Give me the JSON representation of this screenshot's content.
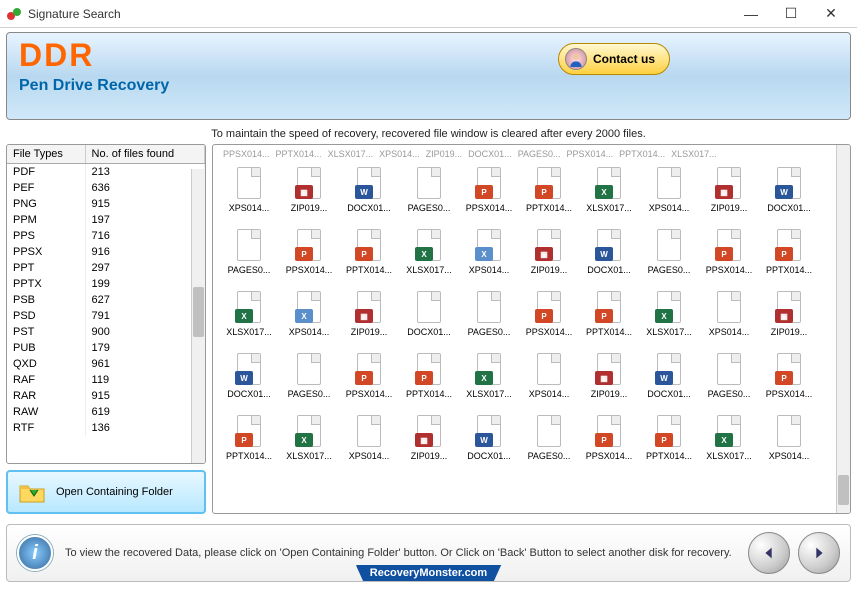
{
  "window": {
    "title": "Signature Search"
  },
  "header": {
    "logo_text": "DDR",
    "subtitle": "Pen Drive Recovery",
    "contact_label": "Contact us"
  },
  "notice": "To maintain the speed of recovery, recovered file window is cleared after every 2000 files.",
  "filetypes": {
    "columns": [
      "File Types",
      "No. of files found"
    ],
    "rows": [
      {
        "type": "PDF",
        "count": "213"
      },
      {
        "type": "PEF",
        "count": "636"
      },
      {
        "type": "PNG",
        "count": "915"
      },
      {
        "type": "PPM",
        "count": "197"
      },
      {
        "type": "PPS",
        "count": "716"
      },
      {
        "type": "PPSX",
        "count": "916"
      },
      {
        "type": "PPT",
        "count": "297"
      },
      {
        "type": "PPTX",
        "count": "199"
      },
      {
        "type": "PSB",
        "count": "627"
      },
      {
        "type": "PSD",
        "count": "791"
      },
      {
        "type": "PST",
        "count": "900"
      },
      {
        "type": "PUB",
        "count": "179"
      },
      {
        "type": "QXD",
        "count": "961"
      },
      {
        "type": "RAF",
        "count": "119"
      },
      {
        "type": "RAR",
        "count": "915"
      },
      {
        "type": "RAW",
        "count": "619"
      },
      {
        "type": "RTF",
        "count": "136"
      }
    ]
  },
  "open_folder_label": "Open Containing Folder",
  "files_truncated_row": [
    "PPSX014...",
    "PPTX014...",
    "XLSX017...",
    "XPS014...",
    "ZIP019...",
    "DOCX01...",
    "PAGES0...",
    "PPSX014...",
    "PPTX014...",
    "XLSX017..."
  ],
  "file_grid": [
    [
      {
        "name": "XPS014...",
        "kind": "page"
      },
      {
        "name": "ZIP019...",
        "kind": "zip"
      },
      {
        "name": "DOCX01...",
        "kind": "docx"
      },
      {
        "name": "PAGES0...",
        "kind": "page"
      },
      {
        "name": "PPSX014...",
        "kind": "pptx"
      },
      {
        "name": "PPTX014...",
        "kind": "pptx"
      },
      {
        "name": "XLSX017...",
        "kind": "xlsx"
      },
      {
        "name": "XPS014...",
        "kind": "page"
      },
      {
        "name": "ZIP019...",
        "kind": "zip"
      },
      {
        "name": "DOCX01...",
        "kind": "docx"
      }
    ],
    [
      {
        "name": "PAGES0...",
        "kind": "page"
      },
      {
        "name": "PPSX014...",
        "kind": "pptx"
      },
      {
        "name": "PPTX014...",
        "kind": "pptx"
      },
      {
        "name": "XLSX017...",
        "kind": "xlsx"
      },
      {
        "name": "XPS014...",
        "kind": "xps"
      },
      {
        "name": "ZIP019...",
        "kind": "zip"
      },
      {
        "name": "DOCX01...",
        "kind": "docx"
      },
      {
        "name": "PAGES0...",
        "kind": "page"
      },
      {
        "name": "PPSX014...",
        "kind": "pptx"
      },
      {
        "name": "PPTX014...",
        "kind": "pptx"
      }
    ],
    [
      {
        "name": "XLSX017...",
        "kind": "xlsx"
      },
      {
        "name": "XPS014...",
        "kind": "xps"
      },
      {
        "name": "ZIP019...",
        "kind": "zip"
      },
      {
        "name": "DOCX01...",
        "kind": "page"
      },
      {
        "name": "PAGES0...",
        "kind": "page"
      },
      {
        "name": "PPSX014...",
        "kind": "pptx"
      },
      {
        "name": "PPTX014...",
        "kind": "pptx"
      },
      {
        "name": "XLSX017...",
        "kind": "xlsx"
      },
      {
        "name": "XPS014...",
        "kind": "page"
      },
      {
        "name": "ZIP019...",
        "kind": "zip"
      }
    ],
    [
      {
        "name": "DOCX01...",
        "kind": "docx"
      },
      {
        "name": "PAGES0...",
        "kind": "page"
      },
      {
        "name": "PPSX014...",
        "kind": "pptx"
      },
      {
        "name": "PPTX014...",
        "kind": "pptx"
      },
      {
        "name": "XLSX017...",
        "kind": "xlsx"
      },
      {
        "name": "XPS014...",
        "kind": "page"
      },
      {
        "name": "ZIP019...",
        "kind": "zip"
      },
      {
        "name": "DOCX01...",
        "kind": "docx"
      },
      {
        "name": "PAGES0...",
        "kind": "page"
      },
      {
        "name": "PPSX014...",
        "kind": "pptx"
      }
    ],
    [
      {
        "name": "PPTX014...",
        "kind": "pptx"
      },
      {
        "name": "XLSX017...",
        "kind": "xlsx"
      },
      {
        "name": "XPS014...",
        "kind": "page"
      },
      {
        "name": "ZIP019...",
        "kind": "zip"
      },
      {
        "name": "DOCX01...",
        "kind": "docx"
      },
      {
        "name": "PAGES0...",
        "kind": "page"
      },
      {
        "name": "PPSX014...",
        "kind": "pptx"
      },
      {
        "name": "PPTX014...",
        "kind": "pptx"
      },
      {
        "name": "XLSX017...",
        "kind": "xlsx"
      },
      {
        "name": "XPS014...",
        "kind": "page"
      }
    ]
  ],
  "footer": {
    "text": "To view the recovered Data, please click on 'Open Containing Folder' button. Or Click on 'Back' Button to select another disk for recovery.",
    "brand": "RecoveryMonster.com"
  }
}
